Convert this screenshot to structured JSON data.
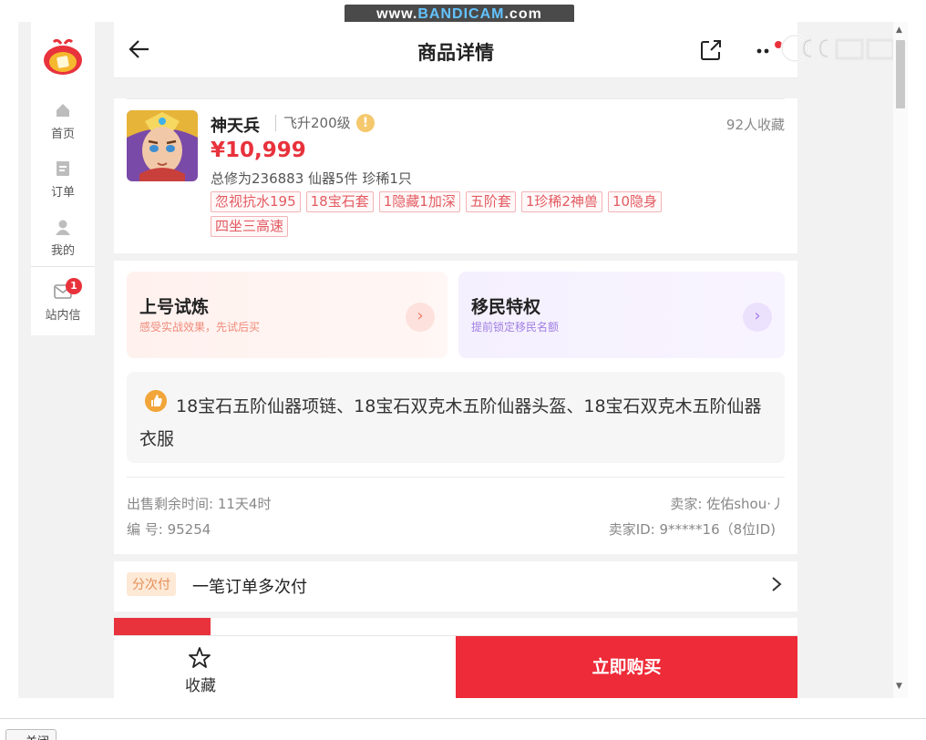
{
  "watermark": {
    "prefix": "www.",
    "brand": "BANDICAM",
    "suffix": ".com"
  },
  "nav": {
    "items": [
      {
        "label": "首页"
      },
      {
        "label": "订单"
      },
      {
        "label": "我的"
      },
      {
        "label": "站内信",
        "badge": "1"
      }
    ]
  },
  "header": {
    "title": "商品详情"
  },
  "peek": {
    "text": "手 一 一 二 三 口 (口 口 一 口 )"
  },
  "product": {
    "name": "神天兵",
    "level": "飞升200级",
    "warning": "!",
    "favorites": "92人收藏",
    "price": "¥10,999",
    "stats": "总修为236883  仙器5件  珍稀1只",
    "tags": [
      "忽视抗水195",
      "18宝石套",
      "1隐藏1加深",
      "五阶套",
      "1珍稀2神兽",
      "10隐身",
      "四坐三高速"
    ]
  },
  "promos": [
    {
      "title": "上号试炼",
      "subtitle": "感受实战效果，先试后买",
      "arrow": "›"
    },
    {
      "title": "移民特权",
      "subtitle": "提前锁定移民名额",
      "arrow": "›"
    }
  ],
  "highlight": {
    "text": "18宝石五阶仙器项链、18宝石双克木五阶仙器头盔、18宝石双克木五阶仙器衣服"
  },
  "meta": {
    "remaining": "出售剩余时间: 11天4时",
    "number": "编 号: 95254",
    "seller": "卖家: 佐佑shou·丿",
    "seller_id": "卖家ID: 9*****16（8位ID)"
  },
  "installment": {
    "pill": "分次付",
    "text": "一笔订单多次付"
  },
  "bottom": {
    "favorite_label": "收藏",
    "buy_label": "立即购买"
  },
  "footer": {
    "close_label": "关闭"
  },
  "colors": {
    "accent": "#e8323c",
    "buy_button": "#ee2b38",
    "tag_text": "#e35b62"
  },
  "icons": [
    "back-arrow-icon",
    "share-icon",
    "more-icon",
    "home-icon",
    "order-icon",
    "user-icon",
    "mail-icon",
    "star-icon",
    "chevron-right-icon",
    "thumbs-up-icon"
  ]
}
